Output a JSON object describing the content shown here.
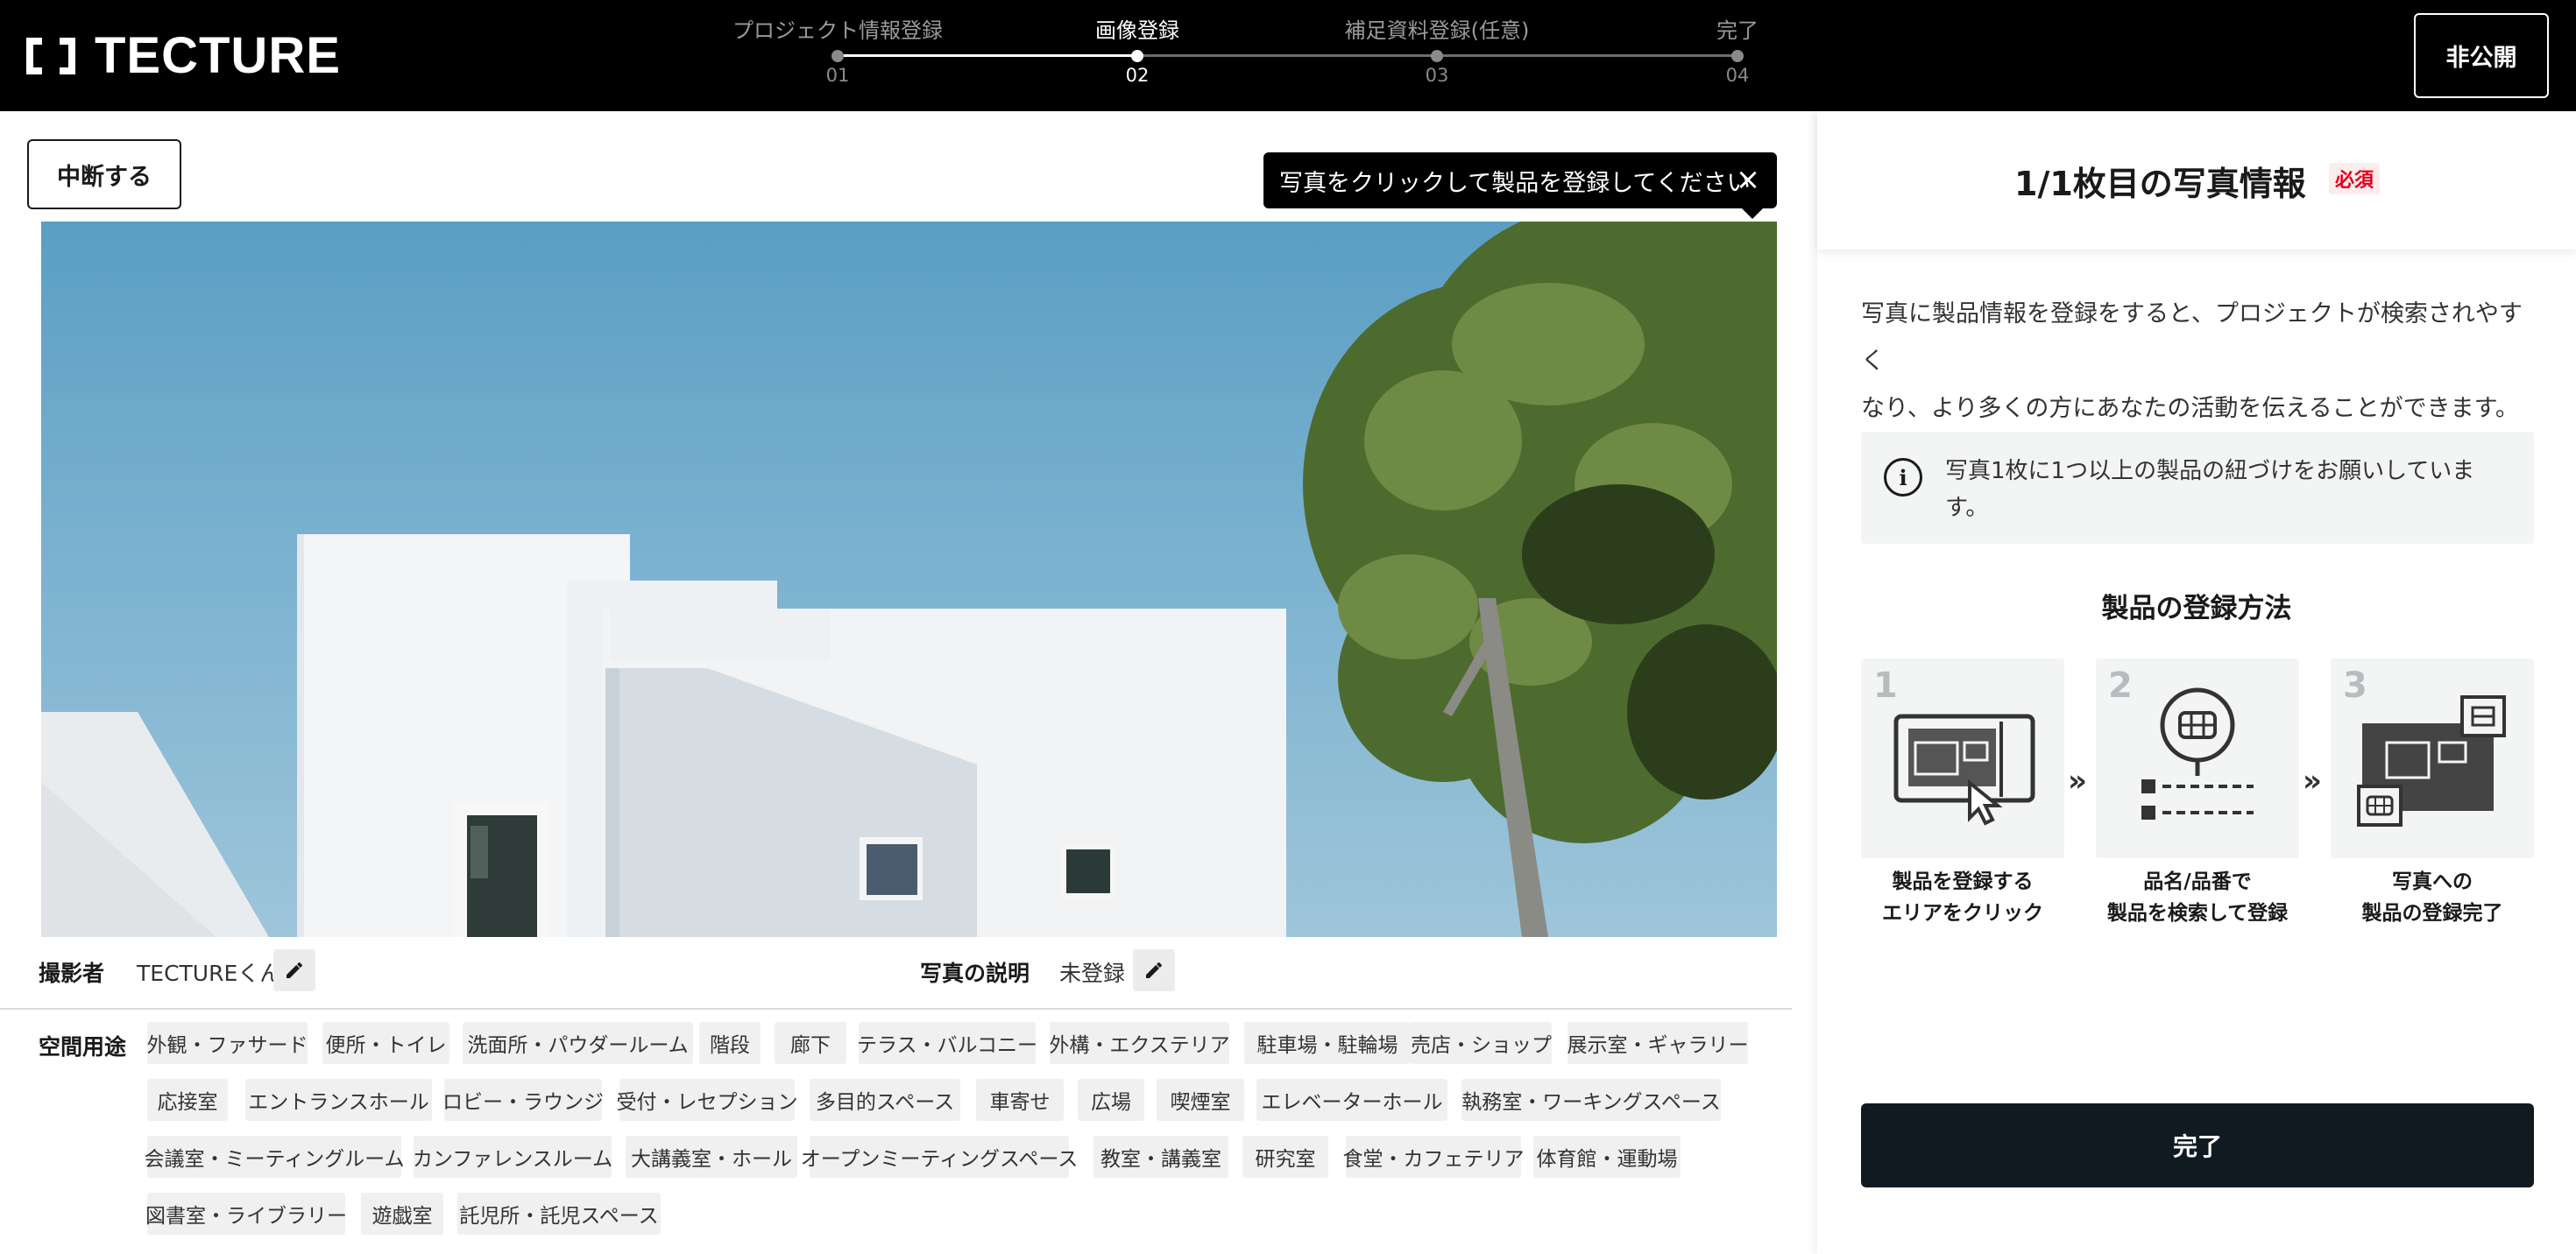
{
  "header": {
    "logo_text": "TECTURE",
    "steps": [
      {
        "label": "プロジェクト情報登録",
        "num": "01"
      },
      {
        "label": "画像登録",
        "num": "02"
      },
      {
        "label": "補足資料登録(任意)",
        "num": "03"
      },
      {
        "label": "完了",
        "num": "04"
      }
    ],
    "active_step": 2,
    "visibility_button": "非公開"
  },
  "main": {
    "pause_button": "中断する",
    "tooltip": "写真をクリックして製品を登録してください",
    "photographer_label": "撮影者",
    "photographer_value": "TECTUREくん",
    "description_label": "写真の説明",
    "description_value": "未登録",
    "space_use_label": "空間用途",
    "space_tags": [
      [
        "外観・ファサード",
        "便所・トイレ",
        "洗面所・パウダールーム",
        "階段",
        "廊下",
        "テラス・バルコニー",
        "外構・エクステリア",
        "駐車場・駐輪場",
        "売店・ショップ",
        "展示室・ギャラリー"
      ],
      [
        "応接室",
        "エントランスホール",
        "ロビー・ラウンジ",
        "受付・レセプション",
        "多目的スペース",
        "車寄せ",
        "広場",
        "喫煙室",
        "エレベーターホール",
        "執務室・ワーキングスペース"
      ],
      [
        "会議室・ミーティングルーム",
        "カンファレンスルーム",
        "大講義室・ホール",
        "オープンミーティングスペース",
        "教室・講義室",
        "研究室",
        "食堂・カフェテリア",
        "体育館・運動場"
      ],
      [
        "図書室・ライブラリー",
        "遊戯室",
        "託児所・託児スペース"
      ]
    ]
  },
  "panel": {
    "title": "1/1枚目の写真情報",
    "required_badge": "必須",
    "intro_line1": "写真に製品情報を登録をすると、プロジェクトが検索されやすく",
    "intro_line2": "なり、より多くの方にあなたの活動を伝えることができます。",
    "notice": "写真1枚に1つ以上の製品の紐づけをお願いしています。",
    "howto_title": "製品の登録方法",
    "steps": [
      {
        "n": "1",
        "line1": "製品を登録する",
        "line2": "エリアをクリック"
      },
      {
        "n": "2",
        "line1": "品名/品番で",
        "line2": "製品を検索して登録"
      },
      {
        "n": "3",
        "line1": "写真への",
        "line2": "製品の登録完了"
      }
    ],
    "chevron": "»",
    "done_button": "完了"
  },
  "colors": {
    "header_bg": "#000000",
    "accent_dark": "#0f1a21",
    "required_red": "#e0001b",
    "tag_bg": "#f0f0f0"
  }
}
